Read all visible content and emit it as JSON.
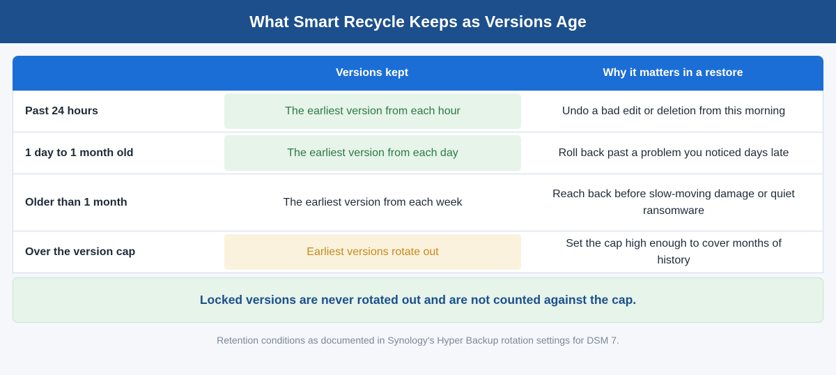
{
  "title": "What Smart Recycle Keeps as Versions Age",
  "table": {
    "headers": [
      "",
      "Versions kept",
      "Why it matters in a restore"
    ],
    "rows": [
      {
        "age": "Past 24 hours",
        "kept": "The earliest version from each hour",
        "why": "Undo a bad edit or deletion from this morning",
        "style": "green"
      },
      {
        "age": "1 day to 1 month old",
        "kept": "The earliest version from each day",
        "why": "Roll back past a problem you noticed days late",
        "style": "green"
      },
      {
        "age": "Older than 1 month",
        "kept": "The earliest version from each week",
        "why": "Reach back before slow-moving damage or quiet ransomware",
        "style": "plain"
      },
      {
        "age": "Over the version cap",
        "kept": "Earliest versions rotate out",
        "why": "Set the cap high enough to cover months of history",
        "style": "amber"
      }
    ]
  },
  "note": "Locked versions are never rotated out and are not counted against the cap.",
  "footer": "Retention conditions as documented in Synology's Hyper Backup rotation settings for DSM 7.",
  "colors": {
    "title_bg": "#1c4f8c",
    "header_bg": "#1b6ed6",
    "green_bg": "#e6f4ea",
    "green_text": "#2d7a43",
    "amber_bg": "#fbf2dd",
    "amber_text": "#c48a1c"
  }
}
